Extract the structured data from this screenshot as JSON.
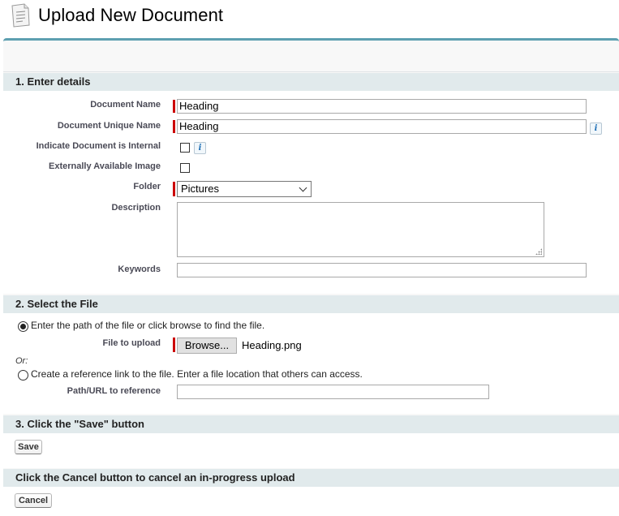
{
  "page": {
    "title": "Upload New Document"
  },
  "sections": {
    "details": "1. Enter details",
    "file": "2. Select the File",
    "save": "3. Click the \"Save\" button",
    "cancel": "Click the Cancel button to cancel an in-progress upload"
  },
  "details": {
    "name_label": "Document Name",
    "name_value": "Heading",
    "unique_label": "Document Unique Name",
    "unique_value": "Heading",
    "internal_label": "Indicate Document is Internal",
    "internal_checked": false,
    "external_label": "Externally Available Image",
    "external_checked": false,
    "folder_label": "Folder",
    "folder_value": "Pictures",
    "description_label": "Description",
    "description_value": "",
    "keywords_label": "Keywords",
    "keywords_value": "",
    "info_glyph": "i"
  },
  "file": {
    "option_path_text": "Enter the path of the file or click browse to find the file.",
    "option_path_selected": true,
    "file_label": "File to upload",
    "browse_label": "Browse...",
    "file_name": "Heading.png",
    "or_text": "Or:",
    "option_ref_text": "Create a reference link to the file. Enter a file location that others can access.",
    "option_ref_selected": false,
    "path_label": "Path/URL to reference",
    "path_value": ""
  },
  "buttons": {
    "save": "Save",
    "cancel": "Cancel"
  },
  "colors": {
    "accent": "#5d9fb0",
    "section_bg": "#e1eaec",
    "required": "#cc0000"
  }
}
